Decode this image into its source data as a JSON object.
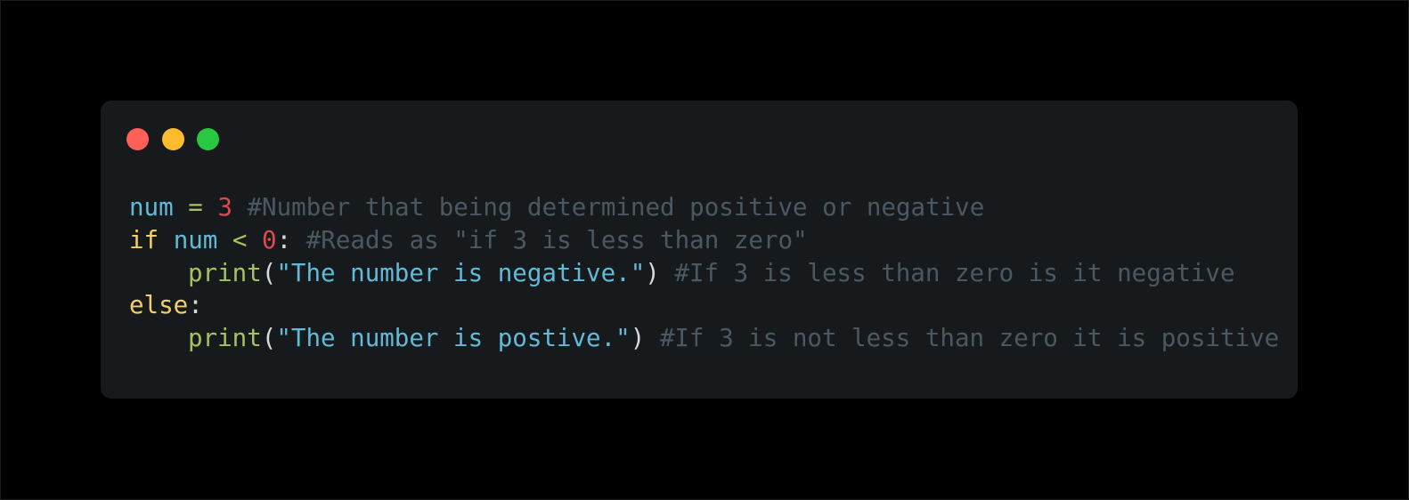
{
  "window": {
    "controls": {
      "close_color": "#fe5f57",
      "minimize_color": "#febc2e",
      "maximize_color": "#28c840"
    }
  },
  "code": {
    "language": "python",
    "lines": [
      [
        {
          "type": "ident",
          "text": "num"
        },
        {
          "type": "op",
          "text": " = "
        },
        {
          "type": "num",
          "text": "3"
        },
        {
          "type": "comment",
          "text": " #Number that being determined positive or negative"
        }
      ],
      [
        {
          "type": "keyword",
          "text": "if"
        },
        {
          "type": "plain",
          "text": " "
        },
        {
          "type": "ident",
          "text": "num"
        },
        {
          "type": "op",
          "text": " < "
        },
        {
          "type": "num",
          "text": "0"
        },
        {
          "type": "punc",
          "text": ":"
        },
        {
          "type": "comment",
          "text": " #Reads as \"if 3 is less than zero\""
        }
      ],
      [
        {
          "type": "func",
          "text": "print"
        },
        {
          "type": "punc",
          "text": "("
        },
        {
          "type": "str",
          "text": "\"The number is negative.\""
        },
        {
          "type": "punc",
          "text": ")"
        },
        {
          "type": "comment",
          "text": " #If 3 is less than zero is it negative"
        }
      ],
      [
        {
          "type": "keyword",
          "text": "else"
        },
        {
          "type": "punc",
          "text": ":"
        }
      ],
      [
        {
          "type": "func",
          "text": "print"
        },
        {
          "type": "punc",
          "text": "("
        },
        {
          "type": "str",
          "text": "\"The number is postive.\""
        },
        {
          "type": "punc",
          "text": ")"
        },
        {
          "type": "comment",
          "text": " #If 3 is not less than zero it is positive"
        }
      ]
    ]
  }
}
